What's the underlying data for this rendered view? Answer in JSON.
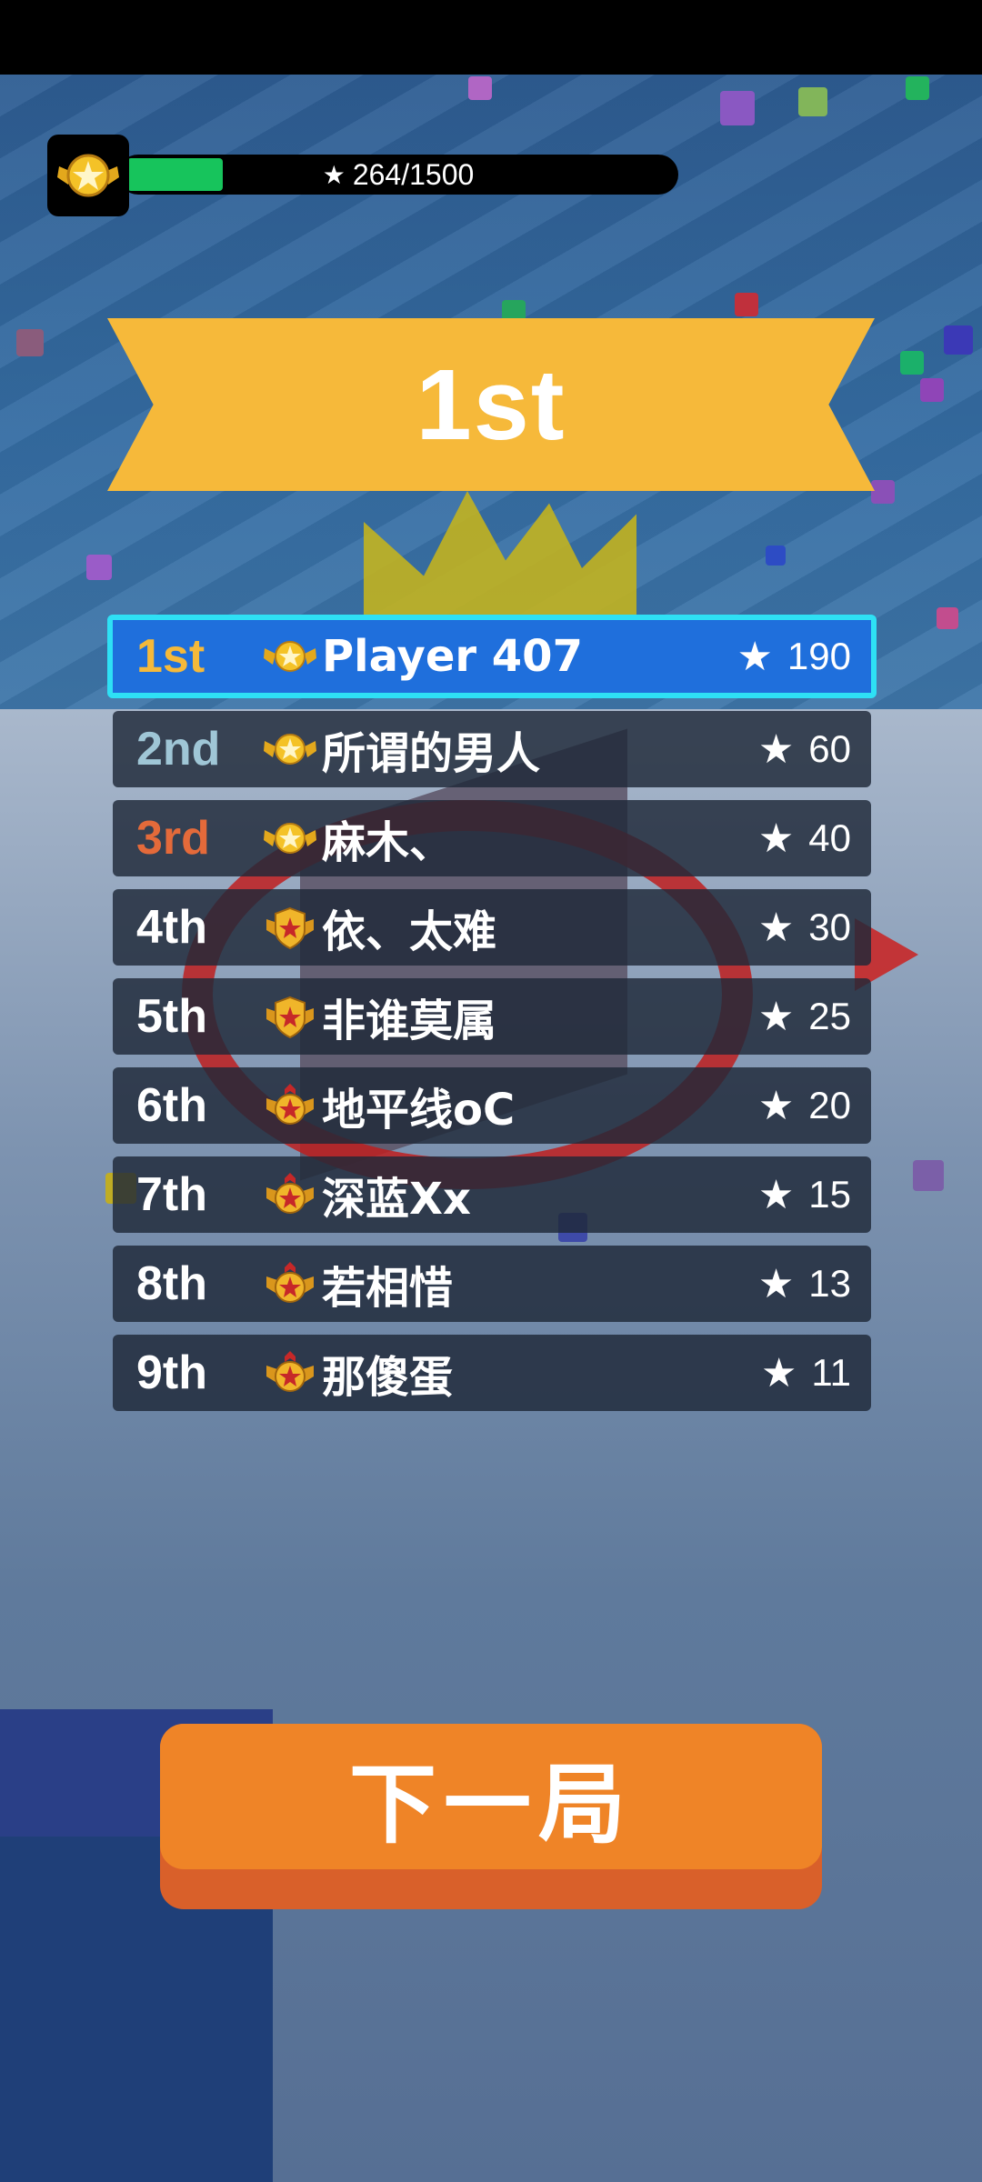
{
  "progress": {
    "current": 264,
    "max": 1500,
    "text": "264/1500",
    "fill_fraction": 0.176,
    "fill_color": "#17c45c"
  },
  "banner": {
    "title": "1st",
    "color": "#f6b93a"
  },
  "leaderboard": [
    {
      "rank": "1st",
      "name": "Player 407",
      "score": "190",
      "rank_color": "#f5b93a",
      "medal": "gold-wing-medal",
      "highlighted": true
    },
    {
      "rank": "2nd",
      "name": "所谓的男人",
      "score": "60",
      "rank_color": "#9fc6d6",
      "medal": "gold-wing-medal"
    },
    {
      "rank": "3rd",
      "name": "麻木、",
      "score": "40",
      "rank_color": "#e46a3a",
      "medal": "gold-wing-medal"
    },
    {
      "rank": "4th",
      "name": "依、太难",
      "score": "30",
      "rank_color": "#ffffff",
      "medal": "gold-shield-medal"
    },
    {
      "rank": "5th",
      "name": "非谁莫属",
      "score": "25",
      "rank_color": "#ffffff",
      "medal": "gold-shield-medal"
    },
    {
      "rank": "6th",
      "name": "地平线oC",
      "score": "20",
      "rank_color": "#ffffff",
      "medal": "gold-cross-medal"
    },
    {
      "rank": "7th",
      "name": "深蓝Xx",
      "score": "15",
      "rank_color": "#ffffff",
      "medal": "gold-cross-medal"
    },
    {
      "rank": "8th",
      "name": "若相惜",
      "score": "13",
      "rank_color": "#ffffff",
      "medal": "gold-cross-medal"
    },
    {
      "rank": "9th",
      "name": "那傻蛋",
      "score": "11",
      "rank_color": "#ffffff",
      "medal": "gold-cross-medal"
    }
  ],
  "next_button": {
    "label": "下一局"
  }
}
